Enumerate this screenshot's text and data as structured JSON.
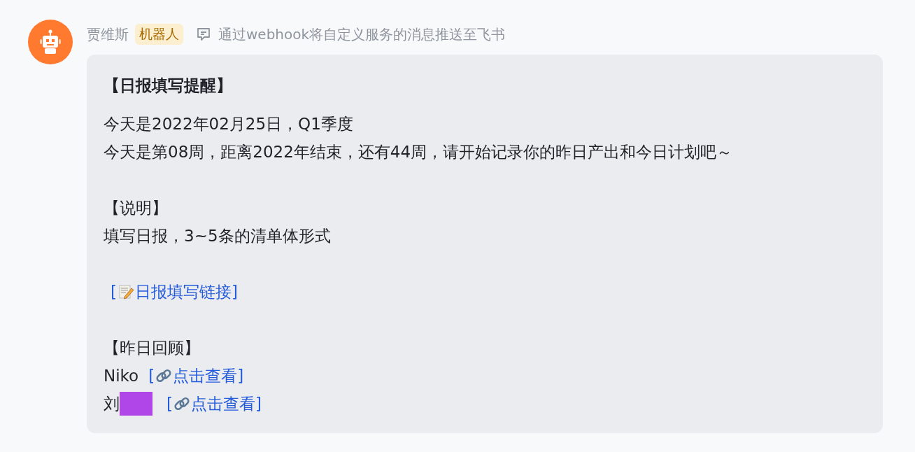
{
  "sender": {
    "name": "贾维斯",
    "badge": "机器人",
    "description": "通过webhook将自定义服务的消息推送至飞书"
  },
  "message": {
    "paragraphs": [
      {
        "lines": [
          {
            "kind": "title",
            "text": "【日报填写提醒】"
          }
        ]
      },
      {
        "lines": [
          {
            "kind": "text",
            "text": "今天是2022年02月25日，Q1季度"
          },
          {
            "kind": "text",
            "text": "今天是第08周，距离2022年结束，还有44周，请开始记录你的昨日产出和今日计划吧～"
          }
        ]
      },
      {
        "lines": [
          {
            "kind": "text",
            "text": "【说明】"
          },
          {
            "kind": "text",
            "text": "填写日报，3~5条的清单体形式"
          }
        ]
      },
      {
        "lines": [
          {
            "kind": "link",
            "link": {
              "kind": "doc",
              "open": "[",
              "label": "日报填写链接]"
            }
          }
        ]
      },
      {
        "lines": [
          {
            "kind": "text",
            "text": "【昨日回顾】"
          },
          {
            "kind": "person",
            "name": "Niko",
            "redacted": false,
            "link": {
              "kind": "chain",
              "open": "[",
              "label": "点击查看]"
            }
          },
          {
            "kind": "person",
            "name": "刘",
            "redacted": true,
            "link": {
              "kind": "chain",
              "open": "[",
              "label": "点击查看]"
            }
          }
        ]
      }
    ]
  }
}
